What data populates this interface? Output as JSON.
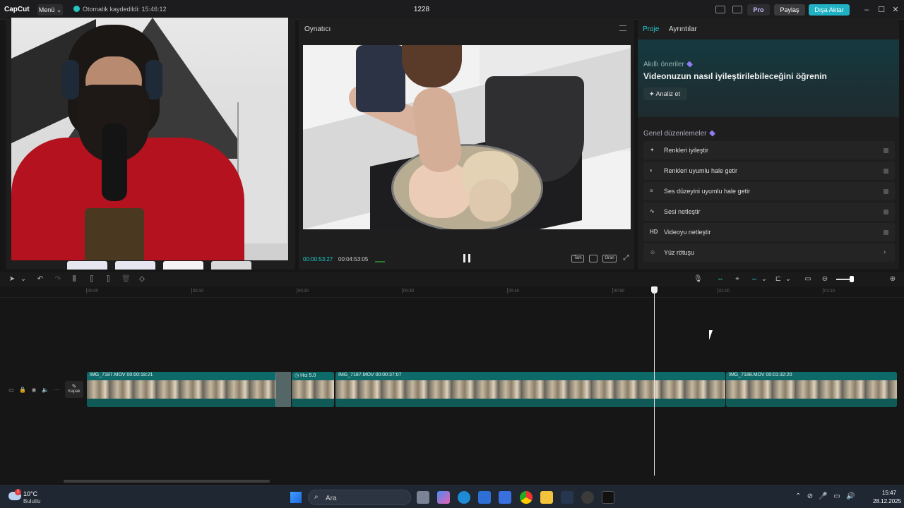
{
  "titlebar": {
    "logo": "CapCut",
    "menu_label": "Menü ⌄",
    "autosave": "Otomatik kaydedildi: 15:46:12",
    "project_name": "1228",
    "pro_label": "Pro",
    "share_label": "Paylaş",
    "export_label": "Dışa Aktar"
  },
  "player": {
    "title": "Oynatıcı",
    "current_time": "00:00:53:27",
    "total_time": "00:04:53:05",
    "btn_full": "Tam",
    "btn_ratio": "Oran"
  },
  "right_panel": {
    "tabs": [
      {
        "label": "Proje"
      },
      {
        "label": "Ayrıntılar"
      }
    ],
    "smart": {
      "subtitle": "Akıllı öneriler",
      "headline": "Videonuzun nasıl iyileştirilebileceğini öğrenin",
      "analyze_label": "Analiz et"
    },
    "general_title": "Genel düzenlemeler",
    "options": [
      {
        "icon": "magic-wand-icon",
        "glyph": "✦",
        "label": "Renkleri iyileştir"
      },
      {
        "icon": "palette-icon",
        "glyph": "◐",
        "label": "Renkleri uyumlu hale getir"
      },
      {
        "icon": "sliders-icon",
        "glyph": "≡",
        "label": "Ses düzeyini uyumlu hale getir"
      },
      {
        "icon": "waveform-icon",
        "glyph": "∿",
        "label": "Sesi netleştir"
      },
      {
        "icon": "hd-icon",
        "glyph": "HD",
        "label": "Videoyu netleştir"
      },
      {
        "icon": "face-retouch-icon",
        "glyph": "☺",
        "label": "Yüz rötuşu"
      }
    ]
  },
  "timeline": {
    "ruler": [
      "00:00",
      "00:10",
      "00:20",
      "00:30",
      "00:40",
      "00:50",
      "01:00",
      "01:10"
    ],
    "cover_label": "Kapak",
    "clips": [
      {
        "head": "IMG_7187.MOV  00:00:18:21"
      },
      {
        "head": "Hız 5.0"
      },
      {
        "head": "IMG_7187.MOV  00:00:37:07"
      },
      {
        "head": "IMG_7188.MOV  00:01:32:20"
      }
    ]
  },
  "taskbar": {
    "weather_badge": "1",
    "temperature": "10°C",
    "weather": "Bulutlu",
    "search_label": "Ara",
    "time": "15:47",
    "date": "28.12.2025"
  }
}
